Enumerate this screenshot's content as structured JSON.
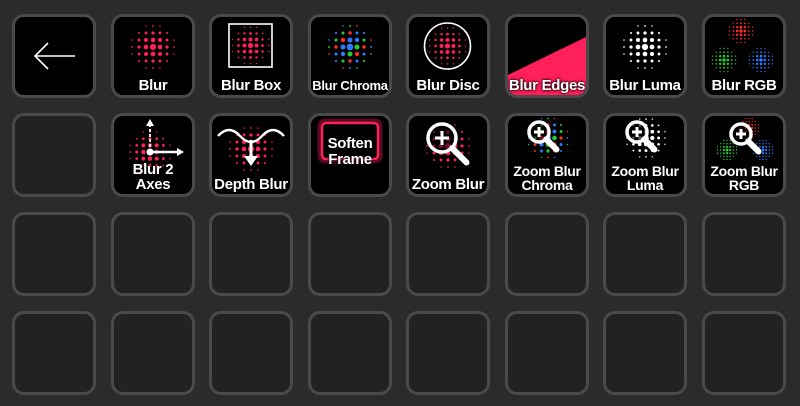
{
  "keys": [
    {
      "id": "back",
      "icon": "back-arrow-icon",
      "label": ""
    },
    {
      "id": "blur",
      "icon": "blur-icon",
      "label": "Blur"
    },
    {
      "id": "blur-box",
      "icon": "blur-box-icon",
      "label": "Blur Box"
    },
    {
      "id": "blur-chroma",
      "icon": "blur-chroma-icon",
      "label": "Blur Chroma"
    },
    {
      "id": "blur-disc",
      "icon": "blur-disc-icon",
      "label": "Blur Disc"
    },
    {
      "id": "blur-edges",
      "icon": "blur-edges-icon",
      "label": "Blur Edges"
    },
    {
      "id": "blur-luma",
      "icon": "blur-luma-icon",
      "label": "Blur Luma"
    },
    {
      "id": "blur-rgb",
      "icon": "blur-rgb-icon",
      "label": "Blur RGB"
    },
    {
      "id": "empty-1",
      "icon": "",
      "label": ""
    },
    {
      "id": "blur-2-axes",
      "icon": "blur-2-axes-icon",
      "label": "Blur 2 Axes"
    },
    {
      "id": "depth-blur",
      "icon": "depth-blur-icon",
      "label": "Depth Blur"
    },
    {
      "id": "soften-frame",
      "icon": "soften-frame-icon",
      "label": "Soften\nFrame"
    },
    {
      "id": "zoom-blur",
      "icon": "zoom-blur-icon",
      "label": "Zoom Blur"
    },
    {
      "id": "zoom-blur-chroma",
      "icon": "zoom-blur-chroma-icon",
      "label": "Zoom Blur\nChroma"
    },
    {
      "id": "zoom-blur-luma",
      "icon": "zoom-blur-luma-icon",
      "label": "Zoom Blur\nLuma"
    },
    {
      "id": "zoom-blur-rgb",
      "icon": "zoom-blur-rgb-icon",
      "label": "Zoom Blur\nRGB"
    },
    {
      "id": "empty-2",
      "icon": "",
      "label": ""
    },
    {
      "id": "empty-3",
      "icon": "",
      "label": ""
    },
    {
      "id": "empty-4",
      "icon": "",
      "label": ""
    },
    {
      "id": "empty-5",
      "icon": "",
      "label": ""
    },
    {
      "id": "empty-6",
      "icon": "",
      "label": ""
    },
    {
      "id": "empty-7",
      "icon": "",
      "label": ""
    },
    {
      "id": "empty-8",
      "icon": "",
      "label": ""
    },
    {
      "id": "empty-9",
      "icon": "",
      "label": ""
    },
    {
      "id": "empty-10",
      "icon": "",
      "label": ""
    },
    {
      "id": "empty-11",
      "icon": "",
      "label": ""
    },
    {
      "id": "empty-12",
      "icon": "",
      "label": ""
    },
    {
      "id": "empty-13",
      "icon": "",
      "label": ""
    },
    {
      "id": "empty-14",
      "icon": "",
      "label": ""
    },
    {
      "id": "empty-15",
      "icon": "",
      "label": ""
    },
    {
      "id": "empty-16",
      "icon": "",
      "label": ""
    },
    {
      "id": "empty-17",
      "icon": "",
      "label": ""
    }
  ],
  "colors": {
    "background": "#2b2b2b",
    "key_border": "#4a4a4a",
    "key_empty": "#222222",
    "key_filled": "#000000",
    "accent": "#ff1f5a",
    "red": "#ff2a2a",
    "green": "#22cc33",
    "blue": "#2a7bff",
    "white": "#ffffff"
  }
}
